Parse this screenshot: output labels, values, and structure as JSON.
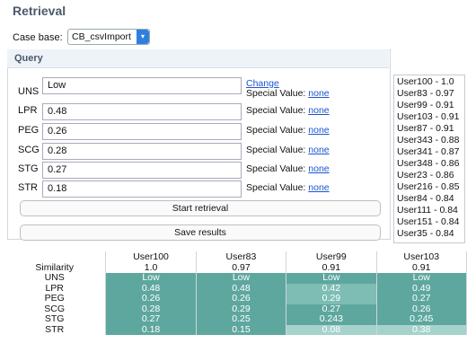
{
  "title": "Retrieval",
  "case_base": {
    "label": "Case base:",
    "value": "CB_csvImport"
  },
  "query": {
    "title": "Query",
    "change_label": "Change",
    "special_value_label": "Special Value:",
    "none_label": "none",
    "fields": [
      {
        "name": "UNS",
        "value": "Low"
      },
      {
        "name": "LPR",
        "value": "0.48"
      },
      {
        "name": "PEG",
        "value": "0.26"
      },
      {
        "name": "SCG",
        "value": "0.28"
      },
      {
        "name": "STG",
        "value": "0.27"
      },
      {
        "name": "STR",
        "value": "0.18"
      }
    ],
    "start_button": "Start retrieval",
    "save_button": "Save results"
  },
  "results": [
    "User100 - 1.0",
    "User83 - 0.97",
    "User99 - 0.91",
    "User103 - 0.91",
    "User87 - 0.91",
    "User343 - 0.88",
    "User341 - 0.87",
    "User348 - 0.86",
    "User23 - 0.86",
    "User216 - 0.85",
    "User84 - 0.84",
    "User111 - 0.84",
    "User151 - 0.84",
    "User35 - 0.84"
  ],
  "table": {
    "columns": [
      "User100",
      "User83",
      "User99",
      "User103"
    ],
    "rows": [
      {
        "label": "Similarity",
        "values": [
          "1.0",
          "0.97",
          "0.91",
          "0.91"
        ]
      },
      {
        "label": "UNS",
        "values": [
          "Low",
          "Low",
          "Low",
          "Low"
        ]
      },
      {
        "label": "LPR",
        "values": [
          "0.48",
          "0.48",
          "0.42",
          "0.49"
        ]
      },
      {
        "label": "PEG",
        "values": [
          "0.26",
          "0.26",
          "0.29",
          "0.27"
        ]
      },
      {
        "label": "SCG",
        "values": [
          "0.28",
          "0.29",
          "0.27",
          "0.26"
        ]
      },
      {
        "label": "STG",
        "values": [
          "0.27",
          "0.25",
          "0.243",
          "0.245"
        ]
      },
      {
        "label": "STR",
        "values": [
          "0.18",
          "0.15",
          "0.08",
          "0.38"
        ]
      }
    ]
  },
  "colors": {
    "dark": "#5ea79f",
    "mid": "#7dbdb3",
    "light": "#a6d2cc",
    "link": "#1a55d0"
  }
}
